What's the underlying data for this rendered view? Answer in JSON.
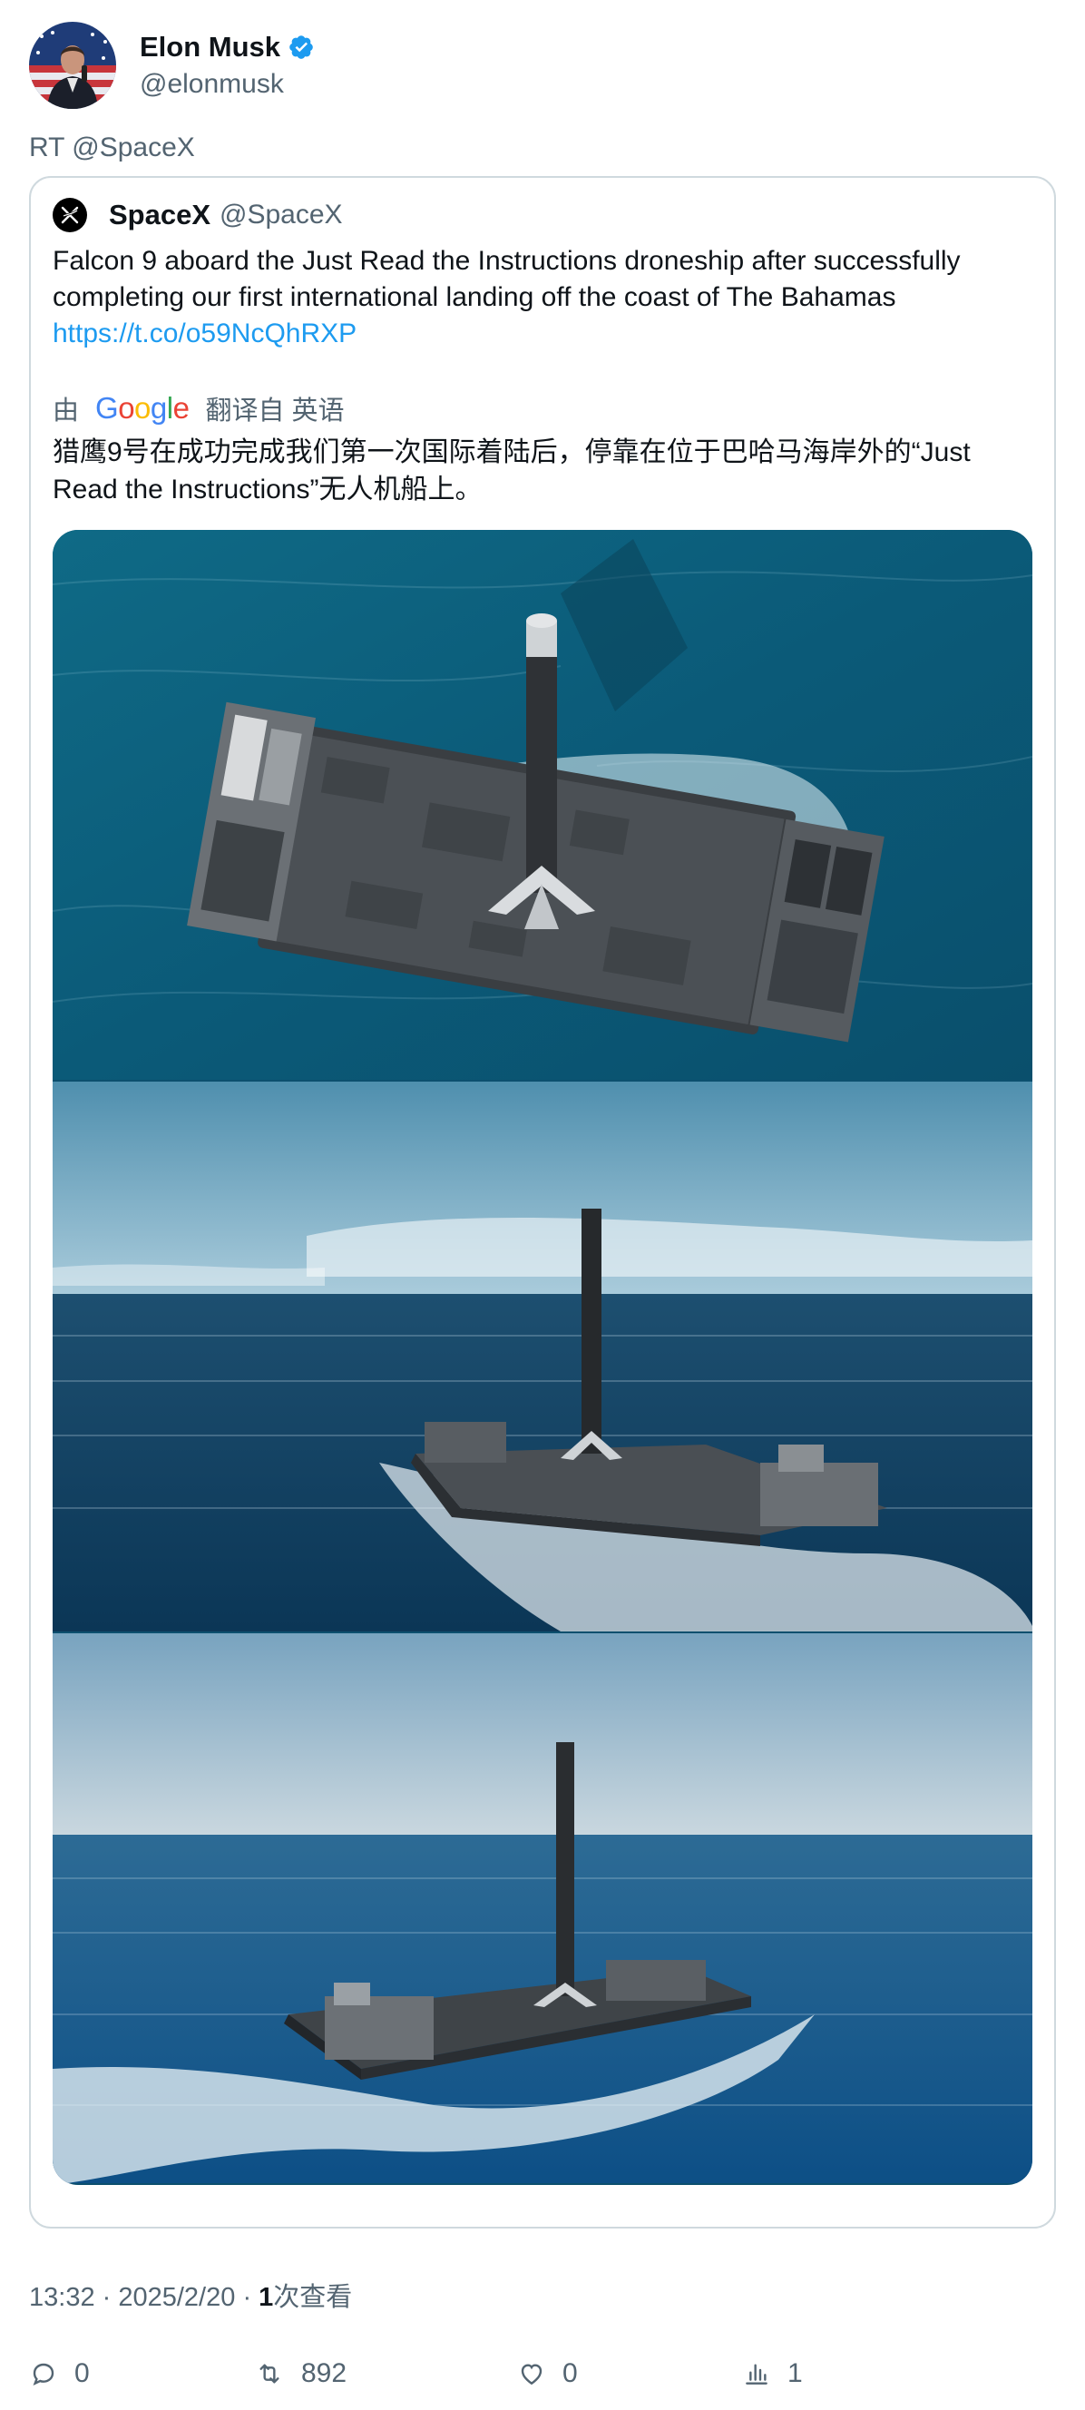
{
  "author": {
    "display_name": "Elon Musk",
    "handle": "@elonmusk",
    "verified": true
  },
  "retweet_label": "RT @SpaceX",
  "quoted": {
    "display_name": "SpaceX",
    "handle": "@SpaceX",
    "text": "Falcon 9 aboard the Just Read the Instructions droneship after successfully completing our first international landing off the coast of The Bahamas ",
    "link": "https://t.co/o59NcQhRXP",
    "translation": {
      "by_label": "由",
      "provider": "Google",
      "from_label": "翻译自 英语",
      "text": "猎鹰9号在成功完成我们第一次国际着陆后，停靠在位于巴哈马海岸外的“Just Read the Instructions”无人机船上。"
    },
    "media_count": 3
  },
  "meta": {
    "time": "13:32",
    "date": "2025/2/20",
    "views_count": "1",
    "views_label": "次查看"
  },
  "actions": {
    "replies": "0",
    "retweets": "892",
    "likes": "0",
    "views": "1"
  },
  "colors": {
    "link": "#1d9bf0",
    "verified": "#1d9bf0",
    "muted": "#536471"
  }
}
